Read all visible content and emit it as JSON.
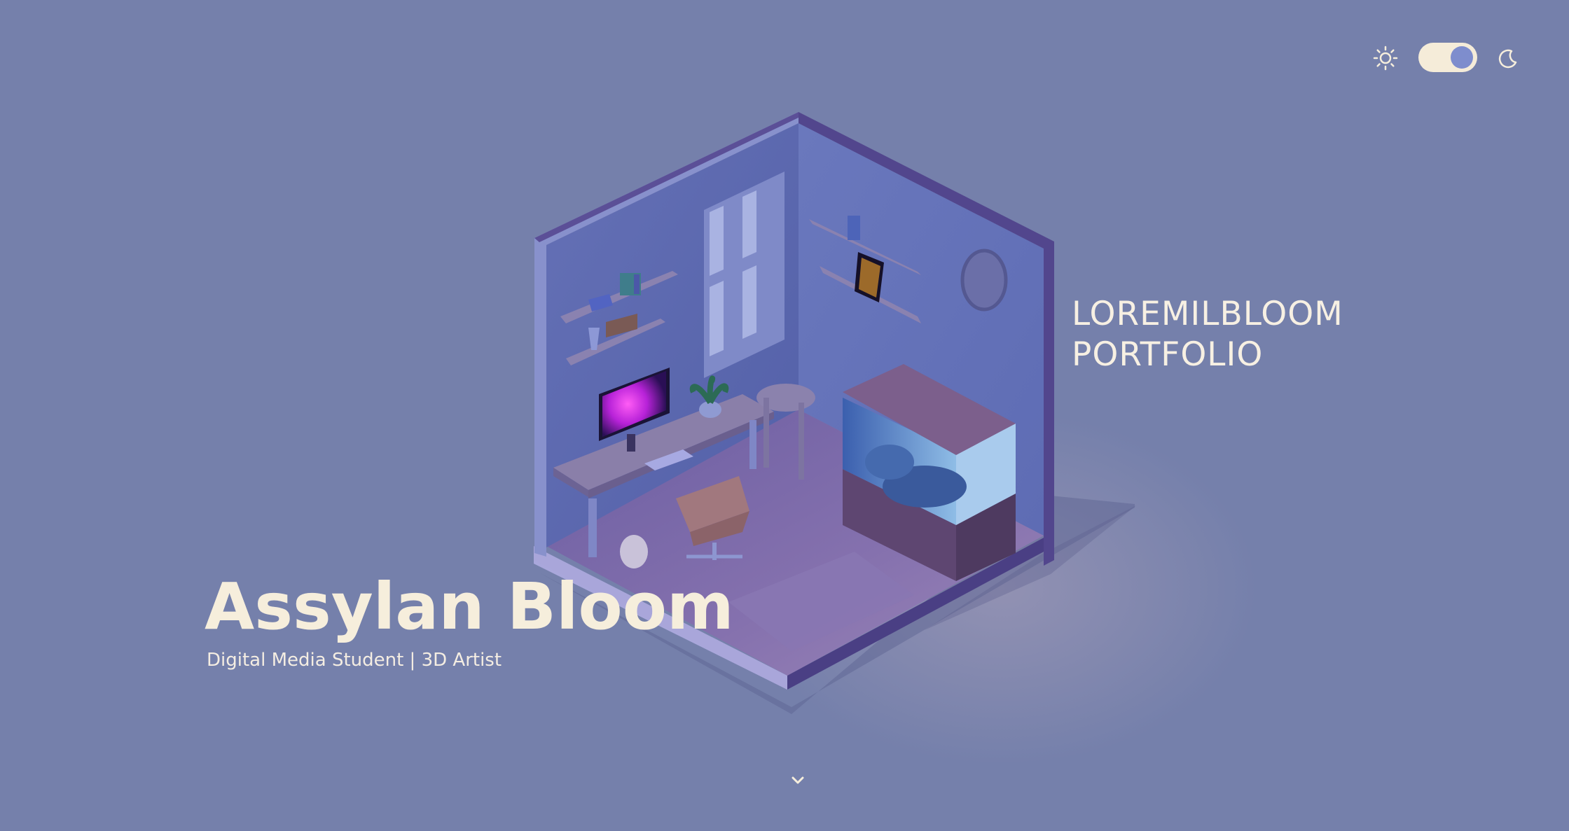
{
  "header": {
    "theme_toggle": {
      "light_icon": "sun-icon",
      "dark_icon": "moon-icon",
      "state": "dark",
      "track_color": "#f5ecd9",
      "knob_color": "#7e8dcd"
    }
  },
  "hero": {
    "portfolio_title_line1": "LOREMILBLOOM",
    "portfolio_title_line2": "PORTFOLIO",
    "name": "Assylan Bloom",
    "subtitle": "Digital Media Student | 3D Artist",
    "scroll_icon": "chevron-down-icon"
  },
  "colors": {
    "background": "#7580ab",
    "text_cream": "#f6eedc",
    "room_wall_left": "#5a66ad",
    "room_wall_right": "#6573b7",
    "room_trim": "#5a4f95",
    "room_floor": "#7a6aa8",
    "monitor_screen": "#b324d6"
  }
}
